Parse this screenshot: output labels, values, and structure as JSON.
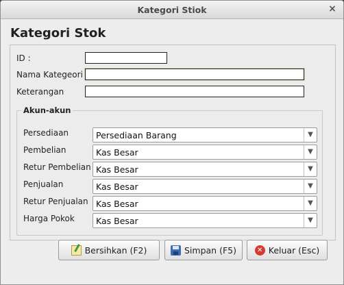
{
  "window": {
    "title": "Kategori Stiok",
    "close_glyph": "×"
  },
  "form": {
    "heading": "Kategori Stok",
    "id_label": "ID :",
    "id_value": "",
    "nama_label": "Nama Kategeori",
    "nama_value": "",
    "keterangan_label": "Keterangan",
    "keterangan_value": ""
  },
  "akun": {
    "legend": "Akun-akun",
    "rows": [
      {
        "label": "Persediaan",
        "value": "Persediaan Barang"
      },
      {
        "label": "Pembelian",
        "value": "Kas Besar"
      },
      {
        "label": "Retur Pembelian",
        "value": "Kas Besar"
      },
      {
        "label": "Penjualan",
        "value": "Kas Besar"
      },
      {
        "label": "Retur Penjualan",
        "value": "Kas Besar"
      },
      {
        "label": "Harga Pokok",
        "value": "Kas Besar"
      }
    ],
    "arrow_glyph": "▼"
  },
  "buttons": {
    "clear_label": "Bersihkan (F2)",
    "save_label": "Simpan (F5)",
    "exit_label": "Keluar (Esc)",
    "clear_icon": "clear-form-icon",
    "save_icon": "floppy-disk-icon",
    "exit_icon": "exit-icon",
    "exit_glyph": "✕"
  }
}
